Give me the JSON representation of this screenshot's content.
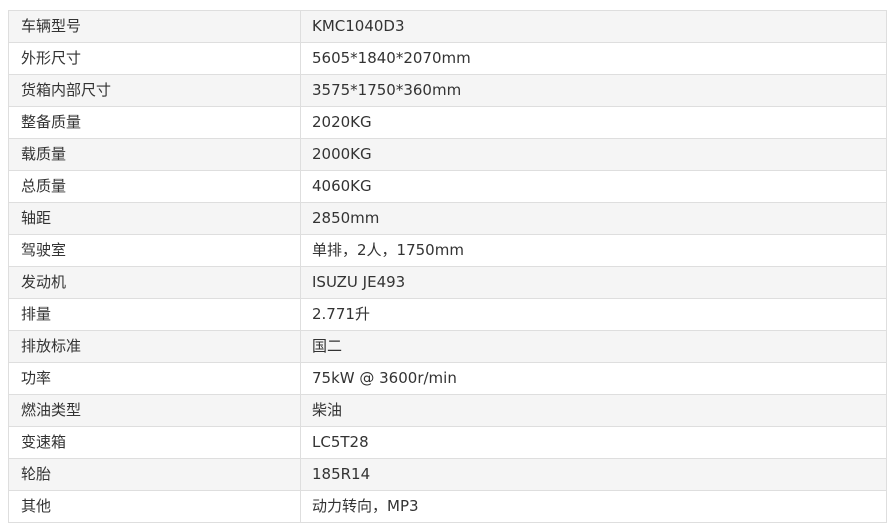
{
  "spec_table": {
    "rows": [
      {
        "label": "车辆型号",
        "value": "KMC1040D3"
      },
      {
        "label": "外形尺寸",
        "value": "5605*1840*2070mm"
      },
      {
        "label": "货箱内部尺寸",
        "value": "3575*1750*360mm"
      },
      {
        "label": "整备质量",
        "value": "2020KG"
      },
      {
        "label": "载质量",
        "value": "2000KG"
      },
      {
        "label": "总质量",
        "value": "4060KG"
      },
      {
        "label": "轴距",
        "value": "2850mm"
      },
      {
        "label": "驾驶室",
        "value": "单排，2人，1750mm"
      },
      {
        "label": "发动机",
        "value": "ISUZU JE493"
      },
      {
        "label": "排量",
        "value": "2.771升"
      },
      {
        "label": "排放标准",
        "value": "国二"
      },
      {
        "label": "功率",
        "value": "75kW @ 3600r/min"
      },
      {
        "label": "燃油类型",
        "value": "柴油"
      },
      {
        "label": "变速箱",
        "value": "LC5T28"
      },
      {
        "label": "轮胎",
        "value": "185R14"
      },
      {
        "label": "其他",
        "value": "动力转向，MP3"
      }
    ]
  }
}
